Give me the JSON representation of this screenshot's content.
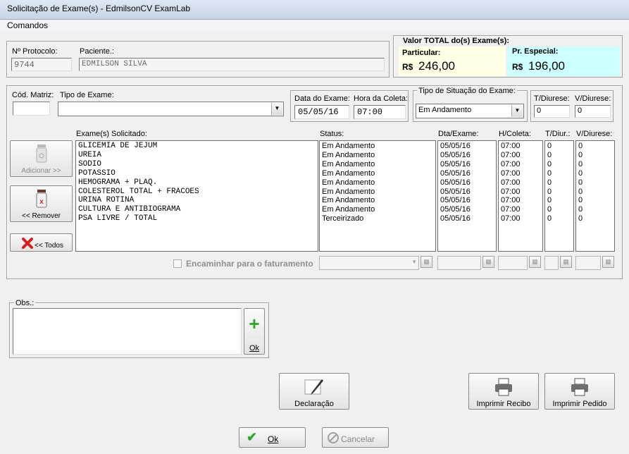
{
  "window": {
    "title": "Solicitação de Exame(s) - EdmilsonCV ExamLab"
  },
  "menu": {
    "comandos": "Comandos"
  },
  "patient": {
    "protocol_label": "Nº Protocolo:",
    "protocol_value": "9744",
    "patient_label": "Paciente.:",
    "patient_value": "EDMILSON SILVA"
  },
  "totals": {
    "title": "Valor TOTAL do(s) Exame(s):",
    "particular_label": "Particular:",
    "particular_currency": "R$",
    "particular_value": "246,00",
    "especial_label": "Pr. Especial:",
    "especial_currency": "R$",
    "especial_value": "196,00"
  },
  "form": {
    "cod_matriz_label": "Cód. Matriz:",
    "cod_matriz_value": "",
    "tipo_exame_label": "Tipo de Exame:",
    "tipo_exame_value": "",
    "data_exame_label": "Data do Exame:",
    "data_exame_value": "05/05/16",
    "hora_coleta_label": "Hora da Coleta:",
    "hora_coleta_value": "07:00",
    "situacao_label": "Tipo de Situação do Exame:",
    "situacao_value": "Em Andamento",
    "t_diurese_label": "T/Diurese:",
    "t_diurese_value": "0",
    "v_diurese_label": "V/Diurese:",
    "v_diurese_value": "0"
  },
  "table": {
    "headers": {
      "exames": "Exame(s) Solicitado:",
      "status": "Status:",
      "dta": "Dta/Exame:",
      "hcoleta": "H/Coleta:",
      "tdiur": "T/Diur.:",
      "vdiurese": "V/Diurese:"
    },
    "rows": [
      {
        "exame": "GLICEMIA DE JEJUM",
        "status": "Em Andamento",
        "dta": "05/05/16",
        "hora": "07:00",
        "t": "0",
        "v": "0"
      },
      {
        "exame": "UREIA",
        "status": "Em Andamento",
        "dta": "05/05/16",
        "hora": "07:00",
        "t": "0",
        "v": "0"
      },
      {
        "exame": "SODIO",
        "status": "Em Andamento",
        "dta": "05/05/16",
        "hora": "07:00",
        "t": "0",
        "v": "0"
      },
      {
        "exame": "POTASSIO",
        "status": "Em Andamento",
        "dta": "05/05/16",
        "hora": "07:00",
        "t": "0",
        "v": "0"
      },
      {
        "exame": "HEMOGRAMA + PLAQ.",
        "status": "Em Andamento",
        "dta": "05/05/16",
        "hora": "07:00",
        "t": "0",
        "v": "0"
      },
      {
        "exame": "COLESTEROL TOTAL + FRACOES",
        "status": "Em Andamento",
        "dta": "05/05/16",
        "hora": "07:00",
        "t": "0",
        "v": "0"
      },
      {
        "exame": "URINA ROTINA",
        "status": "Em Andamento",
        "dta": "05/05/16",
        "hora": "07:00",
        "t": "0",
        "v": "0"
      },
      {
        "exame": "CULTURA E ANTIBIOGRAMA",
        "status": "Em Andamento",
        "dta": "05/05/16",
        "hora": "07:00",
        "t": "0",
        "v": "0"
      },
      {
        "exame": "PSA LIVRE / TOTAL",
        "status": "Terceirizado",
        "dta": "05/05/16",
        "hora": "07:00",
        "t": "0",
        "v": "0"
      }
    ]
  },
  "buttons": {
    "adicionar": "Adicionar >>",
    "remover": "<< Remover",
    "todos": "<< Todos",
    "encaminhar": "Encaminhar para o faturamento",
    "obs_label": "Obs.:",
    "obs_ok": "Ok",
    "declaracao": "Declaração",
    "imprimir_recibo": "Imprimir Recibo",
    "imprimir_pedido": "Imprimir Pedido",
    "ok": "Ok",
    "cancelar": "Cancelar"
  },
  "colors": {
    "particular_bg": "#ffffe6",
    "especial_bg": "#ccffff",
    "green_plus": "#2fa52f",
    "red_x": "#d81f1f"
  }
}
